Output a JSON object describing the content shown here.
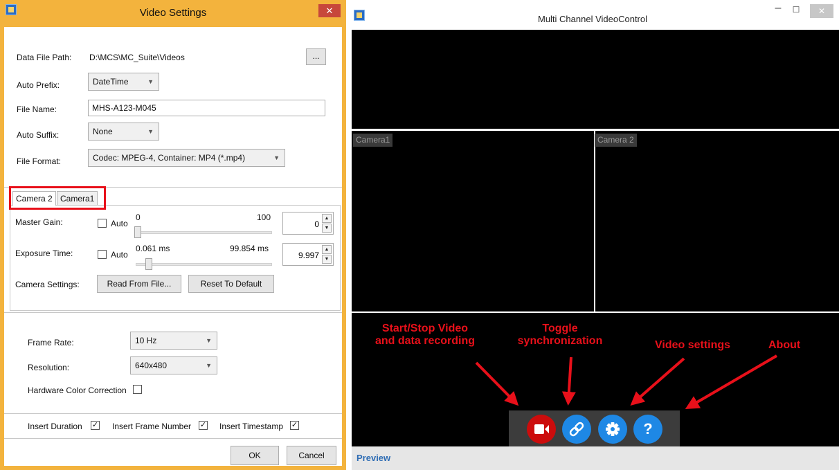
{
  "video_settings": {
    "title": "Video Settings",
    "close_glyph": "✕",
    "data_file_path_label": "Data File Path:",
    "data_file_path_value": "D:\\MCS\\MC_Suite\\Videos",
    "browse_label": "...",
    "auto_prefix_label": "Auto Prefix:",
    "auto_prefix_value": "DateTime",
    "file_name_label": "File Name:",
    "file_name_value": "MHS-A123-M045",
    "auto_suffix_label": "Auto Suffix:",
    "auto_suffix_value": "None",
    "file_format_label": "File Format:",
    "file_format_value": "Codec: MPEG-4, Container: MP4 (*.mp4)",
    "tabs": [
      "Camera 2",
      "Camera1"
    ],
    "master_gain": {
      "label": "Master Gain:",
      "auto_label": "Auto",
      "min_label": "0",
      "max_label": "100",
      "value": "0"
    },
    "exposure_time": {
      "label": "Exposure Time:",
      "auto_label": "Auto",
      "min_label": "0.061 ms",
      "max_label": "99.854 ms",
      "value": "9.997"
    },
    "camera_settings_label": "Camera Settings:",
    "read_from_file_label": "Read From File...",
    "reset_to_default_label": "Reset To Default",
    "frame_rate_label": "Frame Rate:",
    "frame_rate_value": "10 Hz",
    "resolution_label": "Resolution:",
    "resolution_value": "640x480",
    "hw_color_correction_label": "Hardware Color Correction",
    "insert_duration_label": "Insert Duration",
    "insert_frame_number_label": "Insert Frame Number",
    "insert_timestamp_label": "Insert Timestamp",
    "check_glyph": "✓",
    "ok_label": "OK",
    "cancel_label": "Cancel"
  },
  "multi_channel": {
    "title": "Multi Channel VideoControl",
    "minimize_glyph": "–",
    "maximize_glyph": "☐",
    "close_glyph": "✕",
    "camera_labels": [
      "Camera1",
      "Camera 2"
    ],
    "annotations": {
      "start_stop_line1": "Start/Stop Video",
      "start_stop_line2": "and data recording",
      "toggle_line1": "Toggle",
      "toggle_line2": "synchronization",
      "video_settings": "Video settings",
      "about": "About"
    },
    "toolbar_icons": [
      "record-icon",
      "link-icon",
      "gear-icon",
      "help-icon"
    ],
    "about_glyph": "?",
    "status_label": "Preview"
  },
  "colors": {
    "annotation_red": "#e8101a",
    "record_red": "#cc0c0c",
    "toolbar_blue": "#1e88e5",
    "titlebar_orange": "#f3b33d",
    "status_blue": "#2f6db4"
  }
}
